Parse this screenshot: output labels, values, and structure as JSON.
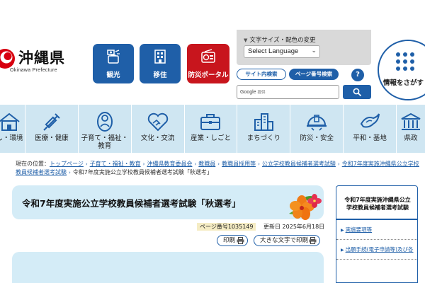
{
  "header": {
    "logo_ja": "沖縄県",
    "logo_en": "Okinawa Prefecture",
    "quick_links": [
      {
        "label": "観光",
        "icon": "tourism-icon"
      },
      {
        "label": "移住",
        "icon": "migration-icon"
      },
      {
        "label": "防災ポータル",
        "icon": "disaster-radio-icon"
      }
    ],
    "tools_title": "文字サイズ・配色の変更",
    "language_select": "Select Language",
    "search_tabs": [
      "サイト内検索",
      "ページ番号検索"
    ],
    "help_label": "?",
    "search_brand": "Google",
    "search_brand_suffix": "提供",
    "jouhou_label": "情報をさがす"
  },
  "categories": [
    {
      "label": "し・環境",
      "icon": "house-icon"
    },
    {
      "label": "医療・健康",
      "icon": "syringe-icon"
    },
    {
      "label": "子育て・福祉・\n教育",
      "icon": "baby-icon"
    },
    {
      "label": "文化・交流",
      "icon": "handshake-heart-icon"
    },
    {
      "label": "産業・しごと",
      "icon": "briefcase-icon"
    },
    {
      "label": "まちづくり",
      "icon": "buildings-icon"
    },
    {
      "label": "防災・安全",
      "icon": "helmet-icon"
    },
    {
      "label": "平和・基地",
      "icon": "dove-icon"
    },
    {
      "label": "県政",
      "icon": "government-icon"
    }
  ],
  "breadcrumb": {
    "prefix": "現在の位置：",
    "links": [
      "トップページ",
      "子育て・福祉・教育",
      "沖縄県教育委員会",
      "教職員",
      "教職員採用等",
      "公立学校教員候補者選考試験",
      "令和7年度実施沖縄県公立学校教員候補者選考試験"
    ],
    "current": "令和7年度実施公立学校教員候補者選考試験「秋選考」"
  },
  "page": {
    "title": "令和7年度実施公立学校教員候補者選考試験「秋選考」",
    "page_number": "ページ番号1035149",
    "updated": "更新日 2025年6月18日",
    "print_label": "印刷",
    "large_print_label": "大きな文字で印刷"
  },
  "side": {
    "heading": "令和7年度実施沖縄県公立学校教員候補者選考試験",
    "items": [
      "実施要項等",
      "出願手続(電子申請等)及び各"
    ]
  },
  "colors": {
    "primary": "#1f5fa8",
    "bosai": "#c8151d",
    "category_bg": "#cfe6f2",
    "title_bg": "#d4ecf7",
    "logo_red": "#d7000f"
  }
}
